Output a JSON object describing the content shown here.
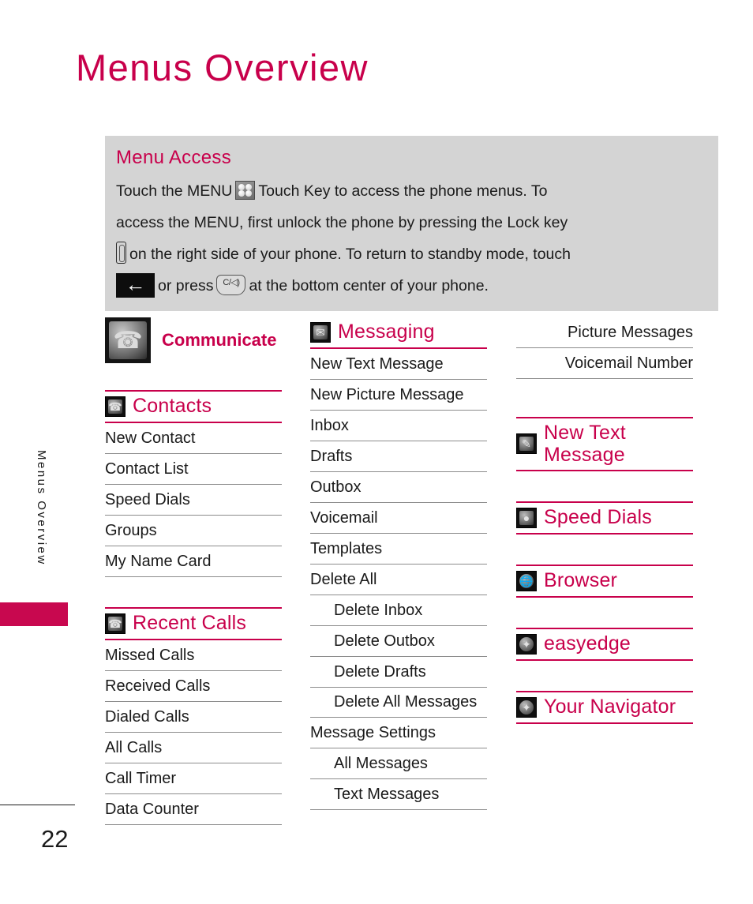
{
  "page": {
    "title": "Menus Overview",
    "side_title": "Menus Overview",
    "page_number": "22"
  },
  "callout": {
    "title": "Menu Access",
    "line1_a": "Touch the MENU",
    "line1_b": "Touch Key to access the phone menus. To",
    "line2": "access the MENU, first unlock the phone by pressing the Lock key",
    "line3": "on the right side of your phone. To return to standby mode, touch",
    "line4_a": "or press",
    "line4_b": "at the bottom center of your phone.",
    "icons": {
      "menu_key": "menu-grid-icon",
      "lock_key": "lock-key-icon",
      "back_key": "back-arrow-icon",
      "clear_key": "clear-key-icon",
      "clear_key_label": "C/◁)"
    }
  },
  "columns": {
    "left": {
      "hero": {
        "label": "Communicate",
        "icon": "phone-handset-icon"
      },
      "sections": [
        {
          "label": "Contacts",
          "icon": "contact-card-icon",
          "items": [
            "New Contact",
            "Contact List",
            "Speed Dials",
            "Groups",
            "My Name Card"
          ]
        },
        {
          "label": "Recent Calls",
          "icon": "recent-calls-icon",
          "items": [
            "Missed Calls",
            "Received Calls",
            "Dialed Calls",
            "All Calls",
            "Call Timer",
            "Data Counter"
          ]
        }
      ]
    },
    "middle": {
      "sections": [
        {
          "label": "Messaging",
          "icon": "envelope-icon",
          "items": [
            {
              "text": "New Text Message",
              "indent": false
            },
            {
              "text": "New Picture Message",
              "indent": false
            },
            {
              "text": "Inbox",
              "indent": false
            },
            {
              "text": "Drafts",
              "indent": false
            },
            {
              "text": "Outbox",
              "indent": false
            },
            {
              "text": "Voicemail",
              "indent": false
            },
            {
              "text": "Templates",
              "indent": false
            },
            {
              "text": "Delete All",
              "indent": false
            },
            {
              "text": "Delete Inbox",
              "indent": true
            },
            {
              "text": "Delete Outbox",
              "indent": true
            },
            {
              "text": "Delete Drafts",
              "indent": true
            },
            {
              "text": "Delete All Messages",
              "indent": true,
              "wrap": true
            },
            {
              "text": "Message Settings",
              "indent": false
            },
            {
              "text": "All Messages",
              "indent": true
            },
            {
              "text": "Text Messages",
              "indent": true
            }
          ]
        }
      ]
    },
    "right": {
      "continued_items": [
        "Picture Messages",
        "Voicemail Number"
      ],
      "sections": [
        {
          "label": "New Text Message",
          "label_line1": "New Text",
          "label_line2": "Message",
          "icon": "compose-note-icon"
        },
        {
          "label": "Speed Dials",
          "icon": "speed-dial-person-icon"
        },
        {
          "label": "Browser",
          "icon": "globe-icon"
        },
        {
          "label": "easyedge",
          "icon": "easyedge-star-icon"
        },
        {
          "label": "Your Navigator",
          "icon": "compass-icon"
        }
      ]
    }
  },
  "colors": {
    "accent": "#c8004b",
    "callout_bg": "#d4d4d4",
    "rule_gray": "#8c8c8c",
    "text": "#1a1a1a"
  }
}
